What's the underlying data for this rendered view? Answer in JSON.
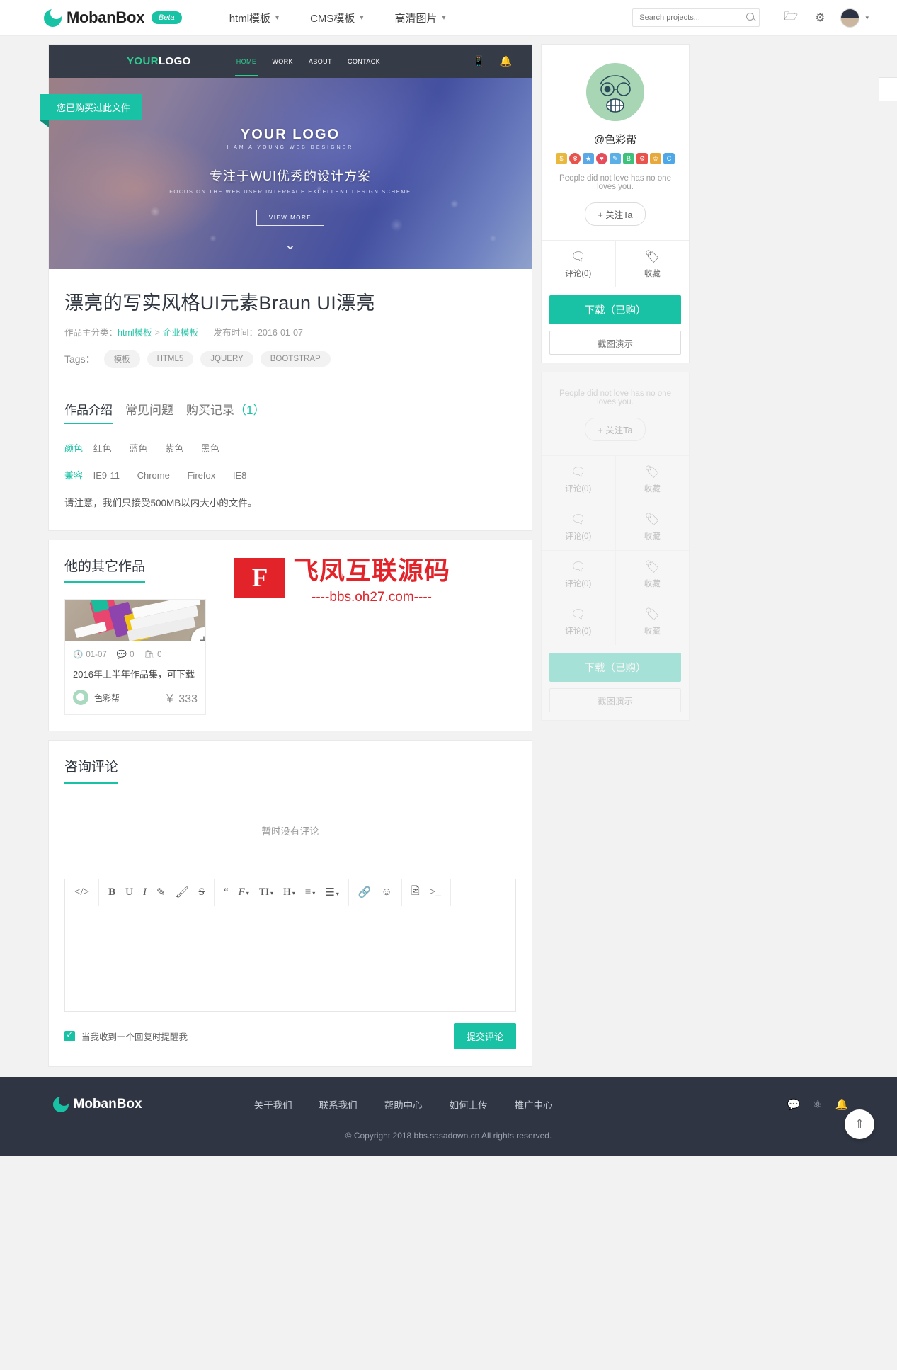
{
  "header": {
    "brand": "MobanBox",
    "beta": "Beta",
    "nav": [
      {
        "label": "html模板",
        "caret": "∨"
      },
      {
        "label": "CMS模板",
        "caret": "∨"
      },
      {
        "label": "高清图片",
        "caret": "∨"
      }
    ],
    "search_placeholder": "Search projects...",
    "icons": [
      "folder-icon",
      "gear-icon",
      "avatar"
    ]
  },
  "preview": {
    "ribbon": "您已购买过此文件",
    "template": {
      "logo_green": "YOUR",
      "logo_white": "LOGO",
      "menu": [
        "HOME",
        "WORK",
        "ABOUT",
        "CONTACK"
      ],
      "hero_logo": "YOUR LOGO",
      "hero_sub": "I AM A YOUNG WEB DESIGNER",
      "hero_cn": "专注于WUI优秀的设计方案",
      "hero_en": "FOCUS ON THE WEB USER INTERFACE EXCELLENT DESIGN SCHEME",
      "hero_btn": "VIEW MORE"
    }
  },
  "project": {
    "title": "漂亮的写实风格UI元素Braun UI漂亮",
    "category_label": "作品主分类：",
    "category_1": "html模板",
    "category_sep": ">",
    "category_2": "企业模板",
    "publish_label": "发布时间：",
    "publish_date": "2016-01-07",
    "tags_label": "Tags：",
    "tags": [
      "模板",
      "HTML5",
      "JQUERY",
      "BOOTSTRAP"
    ]
  },
  "tabs": [
    {
      "label": "作品介绍",
      "active": true
    },
    {
      "label": "常见问题",
      "active": false
    },
    {
      "label": "购买记录",
      "count": "（1）",
      "active": false
    }
  ],
  "detail": {
    "color_key": "颜色",
    "colors": [
      "红色",
      "蓝色",
      "紫色",
      "黑色"
    ],
    "compat_key": "兼容",
    "compat": [
      "IE9-11",
      "Chrome",
      "Firefox",
      "IE8"
    ],
    "note": "请注意，我们只接受500MB以内大小的文件。"
  },
  "watermark": {
    "badge": "F",
    "main": "飞凤互联源码",
    "sub": "----bbs.oh27.com----"
  },
  "other_works": {
    "title": "他的其它作品",
    "items": [
      {
        "date": "01-07",
        "comments": "0",
        "downloads": "0",
        "name": "2016年上半年作品集，可下载",
        "author": "色彩帮",
        "price": "￥ 333"
      }
    ]
  },
  "comments": {
    "title": "咨询评论",
    "empty": "暂时没有评论",
    "editor_tools": [
      "</>",
      "B",
      "U",
      "I",
      "pen-icon",
      "brush-icon",
      "S",
      "“",
      "F",
      "TI",
      "H",
      "list-icon",
      "align-icon",
      "link-icon",
      "emoji-icon",
      "image-icon",
      "code-icon"
    ],
    "notify_label": "当我收到一个回复时提醒我",
    "submit": "提交评论"
  },
  "sidebar": {
    "username": "@色彩帮",
    "slogan": "People did not love has no one loves you.",
    "follow": "+ 关注Ta",
    "actions": [
      {
        "label": "评论(0)",
        "icon": "comment-icon"
      },
      {
        "label": "收藏",
        "icon": "tag-icon"
      }
    ],
    "download": "下载（已购）",
    "demo": "截图演示",
    "badges": [
      "#e8b93c",
      "#e8534c",
      "#5aa9e6",
      "#e64c5a",
      "#5ab0e6",
      "#3ec17b",
      "#e8534c",
      "#e8a93c",
      "#4ea8e8"
    ]
  },
  "footer": {
    "brand": "MobanBox",
    "links": [
      "关于我们",
      "联系我们",
      "帮助中心",
      "如何上传",
      "推广中心"
    ],
    "social": [
      "wechat-icon",
      "weibo-icon",
      "bell-icon"
    ],
    "copyright": "© Copyright 2018 bbs.sasadown.cn All rights reserved.",
    "to_top": "to-top-icon"
  }
}
